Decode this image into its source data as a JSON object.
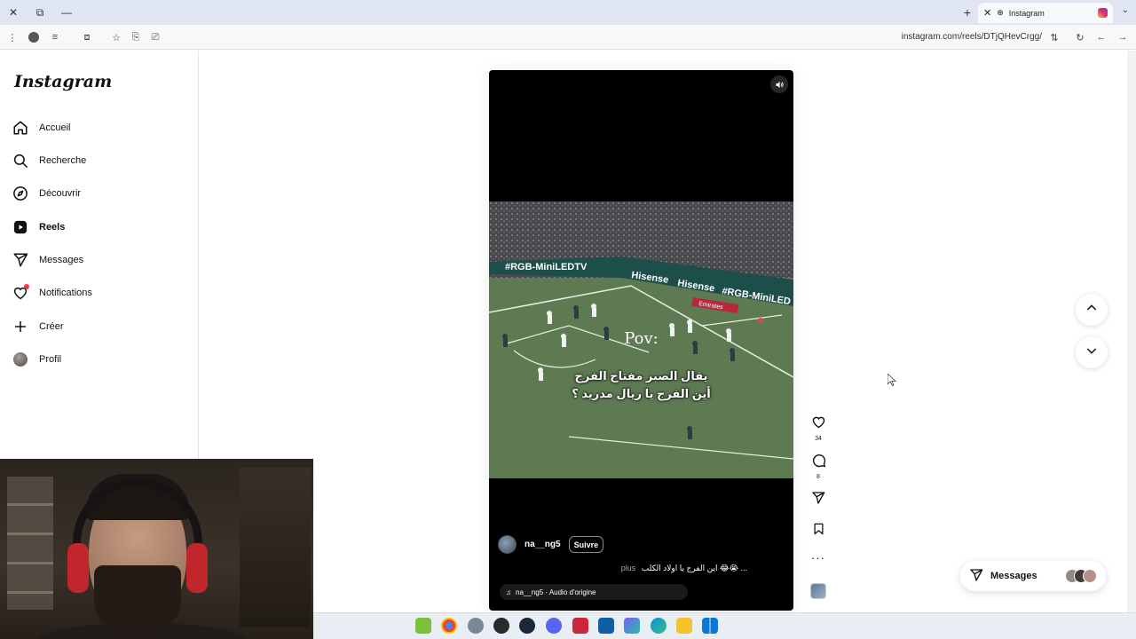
{
  "browser": {
    "tab_title": "Instagram",
    "url": "instagram.com/reels/DTjQHevCrgg/"
  },
  "sidebar": {
    "logo": "Instagram",
    "items": [
      {
        "label": "Accueil",
        "icon": "home-icon"
      },
      {
        "label": "Recherche",
        "icon": "search-icon"
      },
      {
        "label": "Découvrir",
        "icon": "compass-icon"
      },
      {
        "label": "Reels",
        "icon": "reels-icon",
        "active": true
      },
      {
        "label": "Messages",
        "icon": "send-icon"
      },
      {
        "label": "Notifications",
        "icon": "heart-icon"
      },
      {
        "label": "Créer",
        "icon": "plus-icon"
      },
      {
        "label": "Profil",
        "icon": "avatar-icon"
      }
    ]
  },
  "reel": {
    "overlay_title": "Pov:",
    "overlay_line1": "يقال الصبر مفتاح الفرج",
    "overlay_line2": "أين الفرج يا ريال مدريد ؟",
    "username": "na__ng5",
    "follow_label": "Suivre",
    "caption": "اين الفرج يا اولاد الكلب 😂😭 ...",
    "caption_more": "plus",
    "audio": "na__ng5 · Audio d'origine",
    "field_banners": [
      "#RGB-MiniLEDTV",
      "Hisense",
      "Hisense",
      "#RGB-MiniLED",
      "Emirates"
    ]
  },
  "actions": {
    "likes": "34",
    "comments": "8"
  },
  "messages_pill": {
    "label": "Messages"
  },
  "colors": {
    "notification_dot": "#ff3040",
    "pitch_green": "#5d7a52",
    "headset_red": "#c1262c"
  }
}
